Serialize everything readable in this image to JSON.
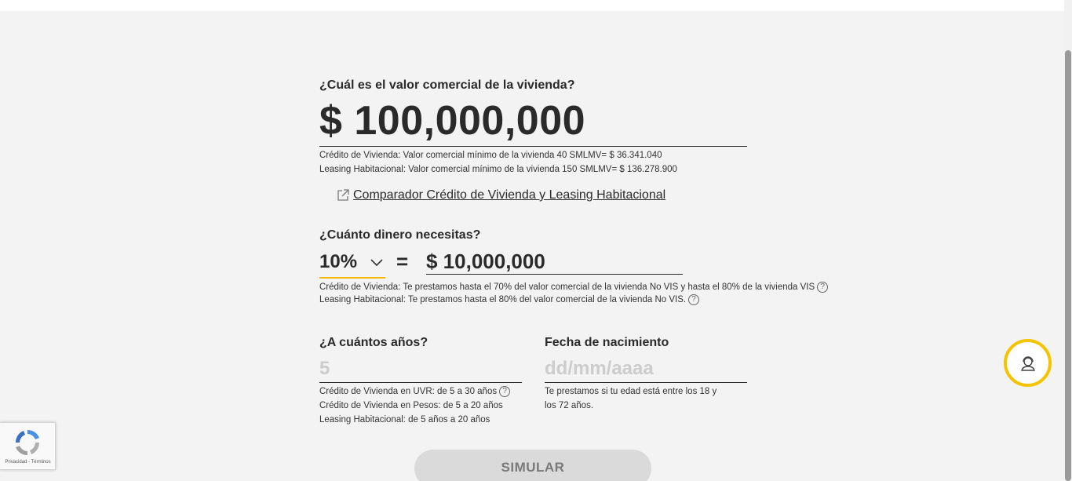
{
  "property": {
    "question": "¿Cuál es el valor comercial de la vivienda?",
    "value": "$ 100,000,000",
    "note_credit": "Crédito de Vivienda: Valor comercial mínimo de la vivienda 40 SMLMV= $ 36.341.040",
    "note_leasing": "Leasing Habitacional: Valor comercial mínimo de la vivienda 150 SMLMV= $ 136.278.900"
  },
  "comparator_link": "Comparador Crédito de Vivienda y Leasing Habitacional",
  "money": {
    "question": "¿Cuánto dinero necesitas?",
    "percent": "10%",
    "equals": "=",
    "amount": "$ 10,000,000",
    "note_credit": "Crédito de Vivienda: Te prestamos hasta el 70% del valor comercial de la vivienda No VIS y hasta el 80% de la vivienda VIS",
    "note_leasing": "Leasing Habitacional: Te prestamos hasta el 80% del valor comercial de la vivienda No VIS."
  },
  "term": {
    "question": "¿A cuántos años?",
    "placeholder": "5",
    "note_uvr": "Crédito de Vivienda en UVR: de 5 a 30 años",
    "note_pesos": "Crédito de Vivienda en Pesos: de 5 a 20 años",
    "note_leasing": "Leasing Habitacional: de 5 años a 20 años"
  },
  "birth": {
    "question": "Fecha de nacimiento",
    "placeholder": "dd/mm/aaaa",
    "note_line1": "Te prestamos si tu edad está entre los 18 y",
    "note_line2": "los 72 años."
  },
  "help_mark": "?",
  "simulate_button": "SIMULAR",
  "recaptcha_text": "Privacidad - Términos",
  "colors": {
    "accent": "#f5c400",
    "text": "#2a2a2a",
    "button_disabled": "#dadada"
  },
  "icons": {
    "external_link": "external-link-icon",
    "chevron": "chevron-down-icon",
    "help": "question-circle-icon",
    "chat": "agent-support-icon"
  }
}
